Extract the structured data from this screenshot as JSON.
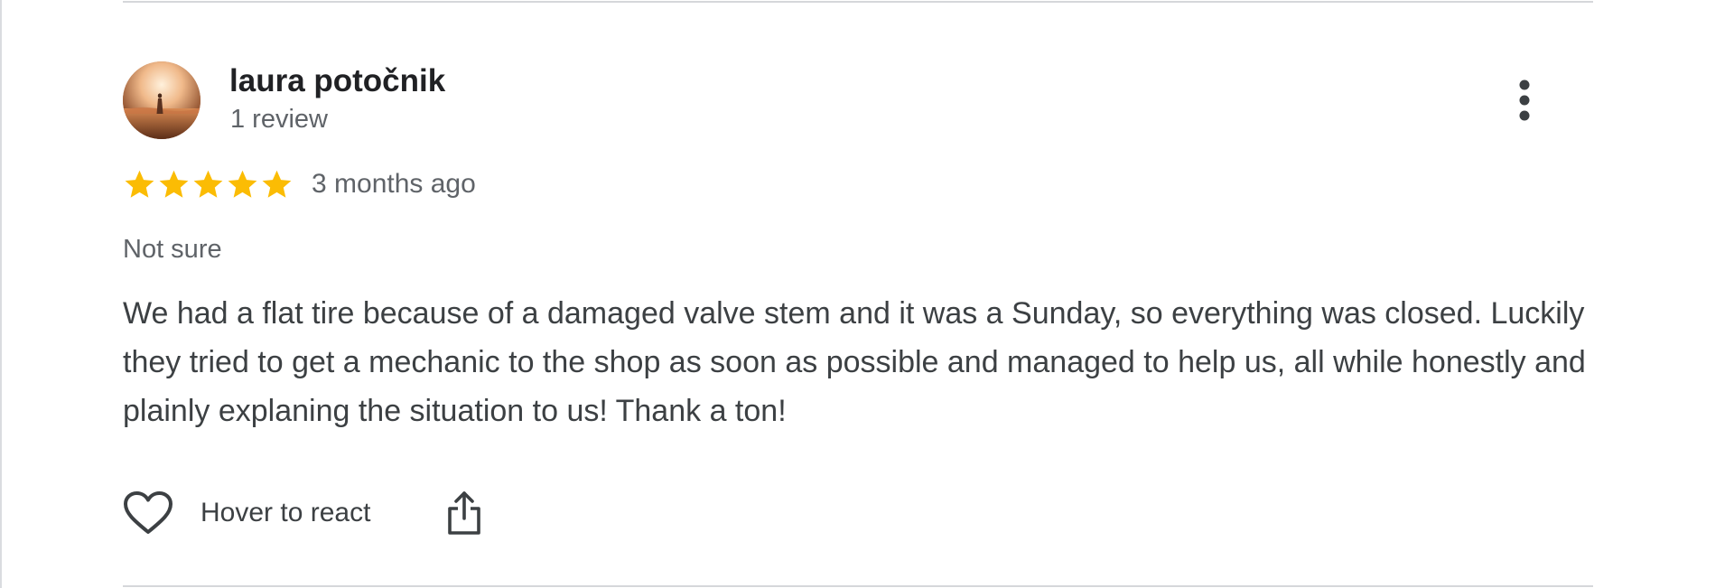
{
  "reviewer": {
    "name": "laura potočnik",
    "review_count": "1 review"
  },
  "rating": {
    "stars": 5,
    "max_stars": 5,
    "date": "3 months ago"
  },
  "review": {
    "subtitle": "Not sure",
    "text": "We had a flat tire because of a damaged valve stem and it was a Sunday, so everything was closed. Luckily they tried to get a mechanic to the shop as soon as possible and managed to help us, all while honestly and plainly explaning the situation to us! Thank a ton!"
  },
  "actions": {
    "react_label": "Hover to react",
    "react_icon": "heart-outline-icon",
    "share_icon": "share-icon",
    "more_icon": "more-vertical-icon"
  },
  "colors": {
    "star": "#fbbc04",
    "name": "#202124",
    "secondary_text": "#5f6368",
    "body_text": "#3c4043",
    "divider": "#d5d7da"
  }
}
